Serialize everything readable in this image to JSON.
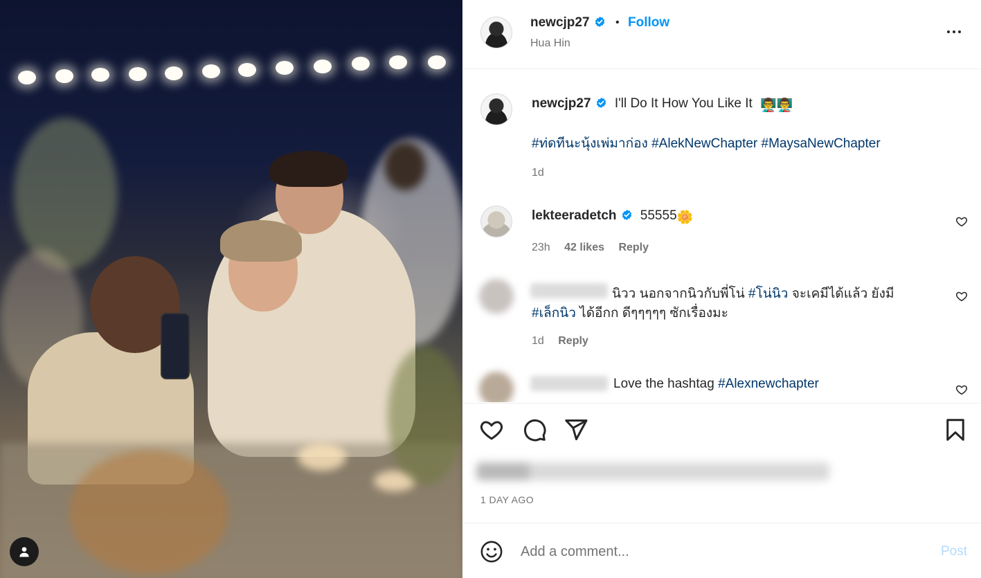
{
  "post": {
    "username": "newcjp27",
    "follow_label": "Follow",
    "separator": "•",
    "location": "Hua Hin",
    "more_icon": "more-horizontal-icon"
  },
  "caption": {
    "username": "newcjp27",
    "text": "I'll Do It How You Like It",
    "emoji": "👨‍🏫👨‍🏫",
    "hashtags": [
      "#ท่ดทีนะนุ้งเพ่มาก่อง",
      "#AlekNewChapter",
      "#MaysaNewChapter"
    ],
    "age": "1d"
  },
  "comments": [
    {
      "username": "lekteeradetch",
      "text": "55555",
      "emoji": "🌼",
      "age": "23h",
      "likes": "42 likes",
      "reply_label": "Reply"
    },
    {
      "username": "",
      "text_before": "นิวว นอกจากนิวกับพี่โน่",
      "tag1": "#โน่นิว",
      "text_middle": "จะเคมีได้แล้ว ยังมี",
      "tag2": "#เล็กนิว",
      "text_after": "ได้อีกก ดีๆๆๆๆๆ ซักเรื่องมะ",
      "age": "1d",
      "reply_label": "Reply"
    },
    {
      "username": "",
      "text": "Love the hashtag",
      "tag": "#Alexnewchapter"
    }
  ],
  "actions": {
    "like_icon": "heart-icon",
    "comment_icon": "comment-icon",
    "share_icon": "send-icon",
    "save_icon": "bookmark-icon",
    "timestamp": "1 DAY AGO"
  },
  "composer": {
    "placeholder": "Add a comment...",
    "post_label": "Post",
    "emoji_icon": "smiley-icon"
  },
  "colors": {
    "link_blue": "#0095f6",
    "hashtag": "#00376b",
    "verified": "#0095f6",
    "post_disabled": "#b3dbff"
  }
}
